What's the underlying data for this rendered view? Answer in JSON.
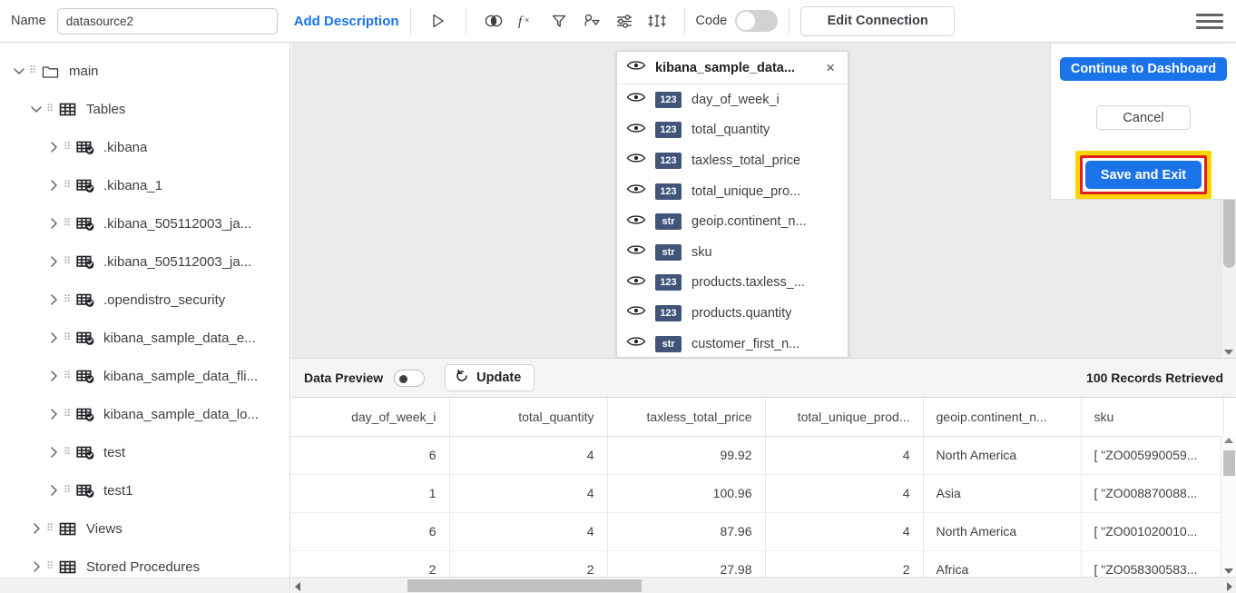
{
  "header": {
    "name_label": "Name",
    "name_value": "datasource2",
    "name_placeholder": "Name",
    "add_description": "Add Description",
    "code_label": "Code",
    "code_toggle_on": false,
    "edit_connection": "Edit Connection",
    "icons": [
      "run-icon",
      "join-icon",
      "function-icon",
      "filter-icon",
      "group-by-icon",
      "settings-sliders-icon",
      "column-settings-icon"
    ]
  },
  "sidebar": {
    "items": [
      {
        "label": "main",
        "icon": "folder-icon",
        "indent": 0,
        "expanded": true,
        "arrow": "chevron-down"
      },
      {
        "label": "Tables",
        "icon": "table-icon",
        "indent": 1,
        "expanded": true,
        "arrow": "chevron-down"
      },
      {
        "label": ".kibana",
        "icon": "table-check-icon",
        "indent": 2,
        "expanded": false,
        "arrow": "chevron-right"
      },
      {
        "label": ".kibana_1",
        "icon": "table-check-icon",
        "indent": 2,
        "expanded": false,
        "arrow": "chevron-right"
      },
      {
        "label": ".kibana_505112003_ja...",
        "icon": "table-check-icon",
        "indent": 2,
        "expanded": false,
        "arrow": "chevron-right"
      },
      {
        "label": ".kibana_505112003_ja...",
        "icon": "table-check-icon",
        "indent": 2,
        "expanded": false,
        "arrow": "chevron-right"
      },
      {
        "label": ".opendistro_security",
        "icon": "table-check-icon",
        "indent": 2,
        "expanded": false,
        "arrow": "chevron-right"
      },
      {
        "label": "kibana_sample_data_e...",
        "icon": "table-check-icon",
        "indent": 2,
        "expanded": false,
        "arrow": "chevron-right"
      },
      {
        "label": "kibana_sample_data_fli...",
        "icon": "table-check-icon",
        "indent": 2,
        "expanded": false,
        "arrow": "chevron-right"
      },
      {
        "label": "kibana_sample_data_lo...",
        "icon": "table-check-icon",
        "indent": 2,
        "expanded": false,
        "arrow": "chevron-right"
      },
      {
        "label": "test",
        "icon": "table-check-icon",
        "indent": 2,
        "expanded": false,
        "arrow": "chevron-right"
      },
      {
        "label": "test1",
        "icon": "table-check-icon",
        "indent": 2,
        "expanded": false,
        "arrow": "chevron-right"
      },
      {
        "label": "Views",
        "icon": "table-icon",
        "indent": 1,
        "expanded": false,
        "arrow": "chevron-right"
      },
      {
        "label": "Stored Procedures",
        "icon": "table-icon",
        "indent": 1,
        "expanded": false,
        "arrow": "chevron-right"
      }
    ]
  },
  "field_panel": {
    "title": "kibana_sample_data...",
    "close_label": "×",
    "fields": [
      {
        "type": "123",
        "name": "day_of_week_i"
      },
      {
        "type": "123",
        "name": "total_quantity"
      },
      {
        "type": "123",
        "name": "taxless_total_price"
      },
      {
        "type": "123",
        "name": "total_unique_pro..."
      },
      {
        "type": "str",
        "name": "geoip.continent_n..."
      },
      {
        "type": "str",
        "name": "sku"
      },
      {
        "type": "123",
        "name": "products.taxless_..."
      },
      {
        "type": "123",
        "name": "products.quantity"
      },
      {
        "type": "str",
        "name": "customer_first_n..."
      }
    ]
  },
  "actions": {
    "continue_to_dashboard": "Continue to Dashboard",
    "cancel": "Cancel",
    "save_and_exit": "Save and Exit",
    "highlight_outer_color": "#ffd400",
    "highlight_inner_color": "#e02020",
    "primary_color": "#1a73e8"
  },
  "preview_bar": {
    "label": "Data Preview",
    "toggle_on": false,
    "update_label": "Update",
    "records_text": "100 Records Retrieved"
  },
  "table": {
    "columns": [
      "day_of_week_i",
      "total_quantity",
      "taxless_total_price",
      "total_unique_prod...",
      "geoip.continent_n...",
      "sku",
      ""
    ],
    "align": [
      "num",
      "num",
      "num",
      "num",
      "txt",
      "txt",
      "txt"
    ],
    "rows": [
      [
        "6",
        "4",
        "99.92",
        "4",
        "North America",
        "[ \"ZO005990059...",
        ""
      ],
      [
        "1",
        "4",
        "100.96",
        "4",
        "Asia",
        "[ \"ZO008870088...",
        ""
      ],
      [
        "6",
        "4",
        "87.96",
        "4",
        "North America",
        "[ \"ZO001020010...",
        ""
      ],
      [
        "2",
        "2",
        "27.98",
        "2",
        "Africa",
        "[ \"ZO058300583...",
        ""
      ]
    ]
  }
}
